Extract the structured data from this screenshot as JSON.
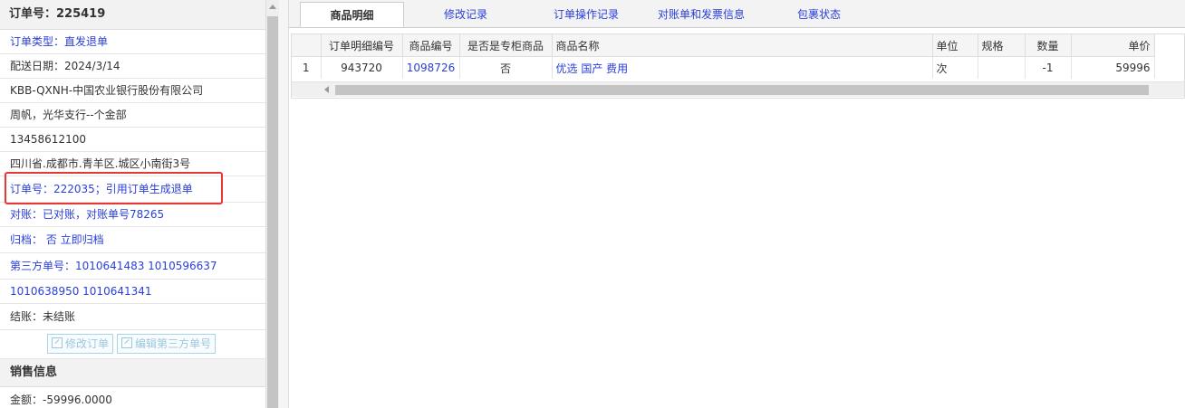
{
  "order": {
    "header": "订单号：225419",
    "fields": [
      {
        "text": "订单类型：直发退单",
        "color": "blue"
      },
      {
        "text": "配送日期：2024/3/14",
        "color": "dark"
      },
      {
        "text": "KBB-QXNH-中国农业银行股份有限公司",
        "color": "dark"
      },
      {
        "text": "周帆，光华支行--个金部",
        "color": "dark"
      },
      {
        "text": "13458612100",
        "color": "dark"
      },
      {
        "text": "四川省.成都市.青羊区.城区小南街3号",
        "color": "dark"
      },
      {
        "text": "订单号：222035；引用订单生成退单",
        "color": "blue"
      },
      {
        "text": "对账：已对账，对账单号78265",
        "color": "blue"
      },
      {
        "text": "归档： 否 立即归档",
        "color": "blue"
      },
      {
        "text": "第三方单号：1010641483 1010596637",
        "color": "blue"
      },
      {
        "text": "1010638950 1010641341",
        "color": "blue"
      },
      {
        "text": "结账：未结账",
        "color": "dark"
      }
    ],
    "buttons": {
      "edit_order": "修改订单",
      "edit_third_party": "编辑第三方单号"
    },
    "sales_section": "销售信息",
    "amount": "金额：-59996.0000"
  },
  "tabs": [
    {
      "label": "商品明细",
      "active": true
    },
    {
      "label": "修改记录",
      "active": false
    },
    {
      "label": "订单操作记录",
      "active": false
    },
    {
      "label": "对账单和发票信息",
      "active": false
    },
    {
      "label": "包裹状态",
      "active": false
    }
  ],
  "grid": {
    "columns": [
      "",
      "订单明细编号",
      "商品编号",
      "是否是专柜商品",
      "商品名称",
      "单位",
      "规格",
      "数量",
      "单价"
    ],
    "rows": [
      [
        "1",
        "943720",
        "1098726",
        "否",
        "优选 国产 费用",
        "次",
        "",
        "-1",
        "59996"
      ]
    ]
  },
  "colors": {
    "link": "#2a3fd8",
    "highlight_border": "#e53935"
  }
}
